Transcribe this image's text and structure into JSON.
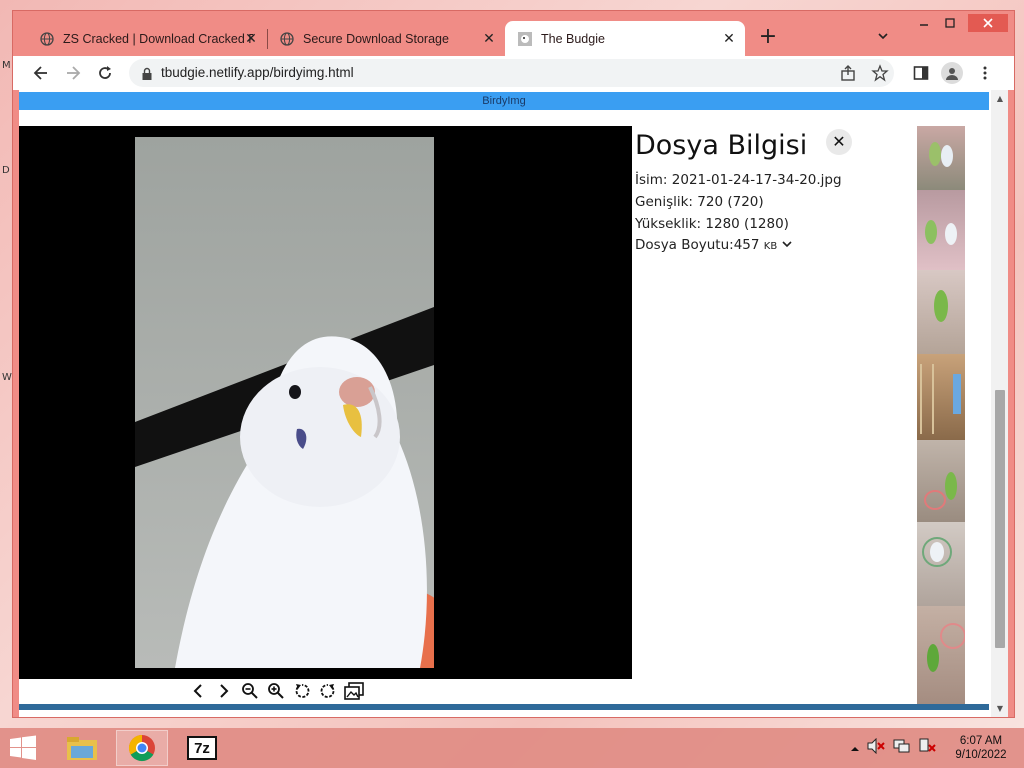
{
  "desktop": {
    "labels": [
      "M",
      "D",
      "W"
    ]
  },
  "browser": {
    "tabs": [
      {
        "title": "ZS Cracked | Download Cracked P",
        "active": false
      },
      {
        "title": "Secure Download Storage",
        "active": false
      },
      {
        "title": "The Budgie",
        "active": true
      }
    ],
    "url": "tbudgie.netlify.app/birdyimg.html"
  },
  "page": {
    "header_title": "BirdyImg",
    "info": {
      "title": "Dosya Bilgisi",
      "name_label": "İsim:",
      "name_value": "2021-01-24-17-34-20.jpg",
      "width_label": "Genişlik:",
      "width_value": "720 (720)",
      "height_label": "Yükseklik:",
      "height_value": "1280 (1280)",
      "size_label": "Dosya Boyutu:",
      "size_value": "457",
      "size_unit": "KB"
    },
    "controls": [
      "prev-icon",
      "next-icon",
      "zoom-out-icon",
      "zoom-in-icon",
      "rotate-left-icon",
      "rotate-right-icon",
      "gallery-icon"
    ]
  },
  "taskbar": {
    "apps": [
      "file-explorer-icon",
      "chrome-icon",
      "7zip-icon"
    ],
    "seven_zip_label": "7z",
    "clock_time": "6:07 AM",
    "clock_date": "9/10/2022"
  },
  "colors": {
    "header_blue": "#3a9ef2",
    "window_frame": "#f08c86",
    "stage_black": "#000000"
  }
}
